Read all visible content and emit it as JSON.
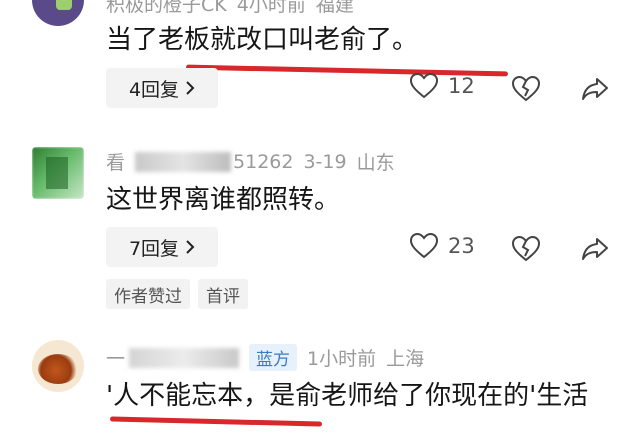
{
  "comments": [
    {
      "author": "积极的橙子CK",
      "time": "4小时前",
      "location": "福建",
      "text": "当了老板就改口叫老俞了。",
      "reply_label": "4回复",
      "likes": "12"
    },
    {
      "author": "看",
      "author_id": "51262",
      "date": "3-19",
      "location": "山东",
      "text": "这世界离谁都照转。",
      "reply_label": "7回复",
      "likes": "23",
      "tags": [
        "作者赞过",
        "首评"
      ]
    },
    {
      "author": "一",
      "badge": "蓝方",
      "time": "1小时前",
      "location": "上海",
      "text": "'人不能忘本，是俞老师给了你现在的'生活"
    }
  ],
  "icons": {
    "like": "heart-icon",
    "dislike": "broken-heart-icon",
    "share": "share-arrow-icon",
    "chevron": "chevron-right-icon"
  },
  "colors": {
    "underline": "#d8282c",
    "meta_text": "#9a9a9a",
    "badge_blue": "#3b7bbf"
  }
}
